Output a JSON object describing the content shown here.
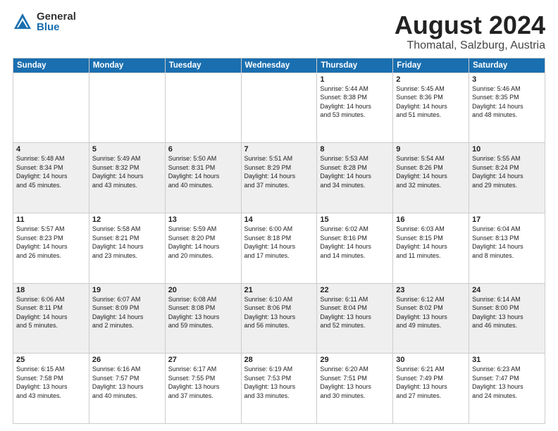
{
  "logo": {
    "general": "General",
    "blue": "Blue"
  },
  "title": "August 2024",
  "location": "Thomatal, Salzburg, Austria",
  "days_of_week": [
    "Sunday",
    "Monday",
    "Tuesday",
    "Wednesday",
    "Thursday",
    "Friday",
    "Saturday"
  ],
  "weeks": [
    [
      {
        "num": "",
        "info": ""
      },
      {
        "num": "",
        "info": ""
      },
      {
        "num": "",
        "info": ""
      },
      {
        "num": "",
        "info": ""
      },
      {
        "num": "1",
        "info": "Sunrise: 5:44 AM\nSunset: 8:38 PM\nDaylight: 14 hours\nand 53 minutes."
      },
      {
        "num": "2",
        "info": "Sunrise: 5:45 AM\nSunset: 8:36 PM\nDaylight: 14 hours\nand 51 minutes."
      },
      {
        "num": "3",
        "info": "Sunrise: 5:46 AM\nSunset: 8:35 PM\nDaylight: 14 hours\nand 48 minutes."
      }
    ],
    [
      {
        "num": "4",
        "info": "Sunrise: 5:48 AM\nSunset: 8:34 PM\nDaylight: 14 hours\nand 45 minutes."
      },
      {
        "num": "5",
        "info": "Sunrise: 5:49 AM\nSunset: 8:32 PM\nDaylight: 14 hours\nand 43 minutes."
      },
      {
        "num": "6",
        "info": "Sunrise: 5:50 AM\nSunset: 8:31 PM\nDaylight: 14 hours\nand 40 minutes."
      },
      {
        "num": "7",
        "info": "Sunrise: 5:51 AM\nSunset: 8:29 PM\nDaylight: 14 hours\nand 37 minutes."
      },
      {
        "num": "8",
        "info": "Sunrise: 5:53 AM\nSunset: 8:28 PM\nDaylight: 14 hours\nand 34 minutes."
      },
      {
        "num": "9",
        "info": "Sunrise: 5:54 AM\nSunset: 8:26 PM\nDaylight: 14 hours\nand 32 minutes."
      },
      {
        "num": "10",
        "info": "Sunrise: 5:55 AM\nSunset: 8:24 PM\nDaylight: 14 hours\nand 29 minutes."
      }
    ],
    [
      {
        "num": "11",
        "info": "Sunrise: 5:57 AM\nSunset: 8:23 PM\nDaylight: 14 hours\nand 26 minutes."
      },
      {
        "num": "12",
        "info": "Sunrise: 5:58 AM\nSunset: 8:21 PM\nDaylight: 14 hours\nand 23 minutes."
      },
      {
        "num": "13",
        "info": "Sunrise: 5:59 AM\nSunset: 8:20 PM\nDaylight: 14 hours\nand 20 minutes."
      },
      {
        "num": "14",
        "info": "Sunrise: 6:00 AM\nSunset: 8:18 PM\nDaylight: 14 hours\nand 17 minutes."
      },
      {
        "num": "15",
        "info": "Sunrise: 6:02 AM\nSunset: 8:16 PM\nDaylight: 14 hours\nand 14 minutes."
      },
      {
        "num": "16",
        "info": "Sunrise: 6:03 AM\nSunset: 8:15 PM\nDaylight: 14 hours\nand 11 minutes."
      },
      {
        "num": "17",
        "info": "Sunrise: 6:04 AM\nSunset: 8:13 PM\nDaylight: 14 hours\nand 8 minutes."
      }
    ],
    [
      {
        "num": "18",
        "info": "Sunrise: 6:06 AM\nSunset: 8:11 PM\nDaylight: 14 hours\nand 5 minutes."
      },
      {
        "num": "19",
        "info": "Sunrise: 6:07 AM\nSunset: 8:09 PM\nDaylight: 14 hours\nand 2 minutes."
      },
      {
        "num": "20",
        "info": "Sunrise: 6:08 AM\nSunset: 8:08 PM\nDaylight: 13 hours\nand 59 minutes."
      },
      {
        "num": "21",
        "info": "Sunrise: 6:10 AM\nSunset: 8:06 PM\nDaylight: 13 hours\nand 56 minutes."
      },
      {
        "num": "22",
        "info": "Sunrise: 6:11 AM\nSunset: 8:04 PM\nDaylight: 13 hours\nand 52 minutes."
      },
      {
        "num": "23",
        "info": "Sunrise: 6:12 AM\nSunset: 8:02 PM\nDaylight: 13 hours\nand 49 minutes."
      },
      {
        "num": "24",
        "info": "Sunrise: 6:14 AM\nSunset: 8:00 PM\nDaylight: 13 hours\nand 46 minutes."
      }
    ],
    [
      {
        "num": "25",
        "info": "Sunrise: 6:15 AM\nSunset: 7:58 PM\nDaylight: 13 hours\nand 43 minutes."
      },
      {
        "num": "26",
        "info": "Sunrise: 6:16 AM\nSunset: 7:57 PM\nDaylight: 13 hours\nand 40 minutes."
      },
      {
        "num": "27",
        "info": "Sunrise: 6:17 AM\nSunset: 7:55 PM\nDaylight: 13 hours\nand 37 minutes."
      },
      {
        "num": "28",
        "info": "Sunrise: 6:19 AM\nSunset: 7:53 PM\nDaylight: 13 hours\nand 33 minutes."
      },
      {
        "num": "29",
        "info": "Sunrise: 6:20 AM\nSunset: 7:51 PM\nDaylight: 13 hours\nand 30 minutes."
      },
      {
        "num": "30",
        "info": "Sunrise: 6:21 AM\nSunset: 7:49 PM\nDaylight: 13 hours\nand 27 minutes."
      },
      {
        "num": "31",
        "info": "Sunrise: 6:23 AM\nSunset: 7:47 PM\nDaylight: 13 hours\nand 24 minutes."
      }
    ]
  ]
}
